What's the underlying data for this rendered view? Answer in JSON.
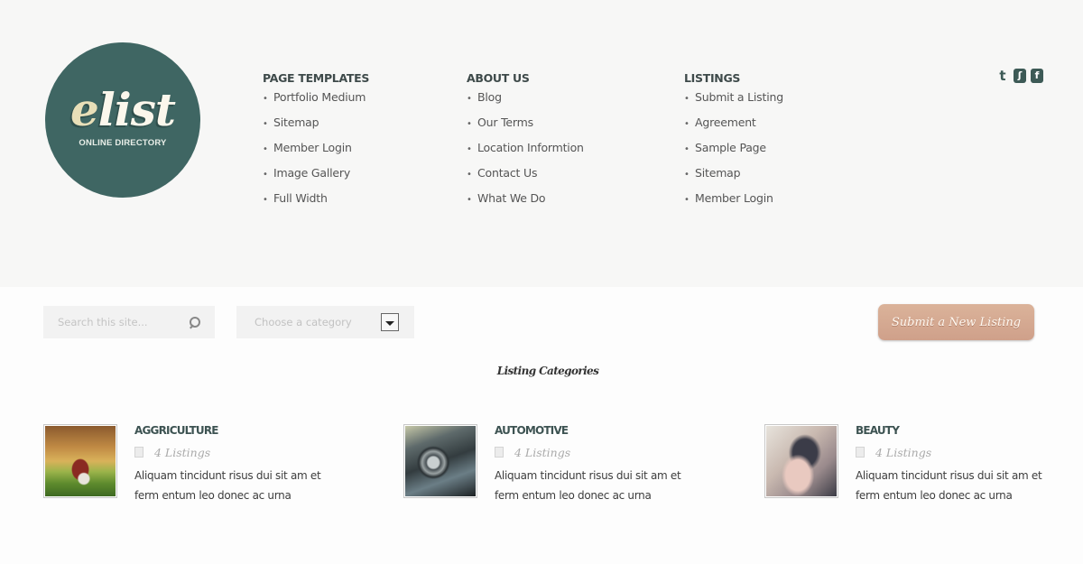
{
  "logo": {
    "wordmark_first": "e",
    "wordmark_rest": "list",
    "tagline": "ONLINE DIRECTORY"
  },
  "menus": [
    {
      "title": "PAGE TEMPLATES",
      "items": [
        "Portfolio Medium",
        "Sitemap",
        "Member Login",
        "Image Gallery",
        "Full Width"
      ]
    },
    {
      "title": "ABOUT US",
      "items": [
        "Blog",
        "Our Terms",
        "Location Informtion",
        "Contact Us",
        "What We Do"
      ]
    },
    {
      "title": "LISTINGS",
      "items": [
        "Submit a Listing",
        "Agreement",
        "Sample Page",
        "Sitemap",
        "Member Login"
      ]
    }
  ],
  "social": {
    "twitter_glyph": "t",
    "rss_glyph": "ʃ",
    "facebook_glyph": "f"
  },
  "search": {
    "placeholder": "Search this site...",
    "value": ""
  },
  "category_select": {
    "selected": "Choose a category"
  },
  "submit_button": {
    "label": "Submit a New Listing"
  },
  "section_title": "Listing Categories",
  "categories": [
    {
      "name": "AGGRICULTURE",
      "count": "4 Listings",
      "description": "Aliquam tincidunt risus dui sit am et ferm entum leo donec ac urna"
    },
    {
      "name": "AUTOMOTIVE",
      "count": "4 Listings",
      "description": "Aliquam tincidunt risus dui sit am et ferm entum leo donec ac urna"
    },
    {
      "name": "BEAUTY",
      "count": "4 Listings",
      "description": "Aliquam tincidunt risus dui sit am et ferm entum leo donec ac urna"
    }
  ],
  "colors": {
    "brand_teal": "#3f6663",
    "button_tan": "#d4a88f",
    "heading_dark": "#3d5352"
  }
}
